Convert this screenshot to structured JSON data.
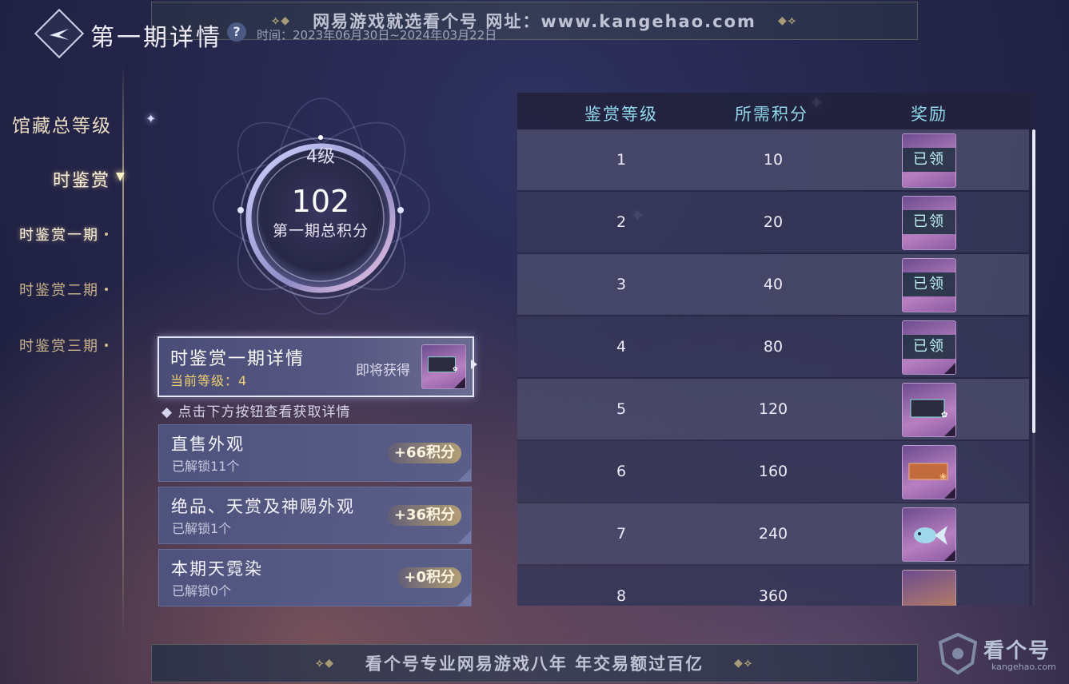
{
  "watermark": {
    "top_text": "网易游戏就选看个号  网址：www.kangehao.com",
    "bottom_text": "看个号专业网易游戏八年  年交易额过百亿"
  },
  "header": {
    "title": "第一期详情",
    "help_icon": "question-icon",
    "date_range": "时间：2023年06月30日~2024年03月22日"
  },
  "sidebar": {
    "top_label": "馆藏总等级",
    "group_label": "时鉴赏",
    "items": [
      {
        "label": "时鉴赏一期",
        "active": true
      },
      {
        "label": "时鉴赏二期",
        "active": false
      },
      {
        "label": "时鉴赏三期",
        "active": false
      }
    ]
  },
  "score": {
    "level": "4级",
    "total": "102",
    "label": "第一期总积分"
  },
  "detail_card": {
    "title": "时鉴赏一期详情",
    "current_level": "当前等级：4",
    "soon_label": "即将获得"
  },
  "hint": "◆ 点击下方按钮查看获取详情",
  "categories": [
    {
      "name": "直售外观",
      "unlocked": "已解锁11个",
      "points": "+66积分"
    },
    {
      "name": "绝品、天赏及神赐外观",
      "unlocked": "已解锁1个",
      "points": "+36积分"
    },
    {
      "name": "本期天霓染",
      "unlocked": "已解锁0个",
      "points": "+0积分"
    }
  ],
  "table": {
    "headers": [
      "鉴赏等级",
      "所需积分",
      "奖励"
    ],
    "claimed_label": "已领",
    "rows": [
      {
        "level": "1",
        "points": "10",
        "claimed": true
      },
      {
        "level": "2",
        "points": "20",
        "claimed": true
      },
      {
        "level": "3",
        "points": "40",
        "claimed": true
      },
      {
        "level": "4",
        "points": "80",
        "claimed": true
      },
      {
        "level": "5",
        "points": "120",
        "claimed": false
      },
      {
        "level": "6",
        "points": "160",
        "claimed": false
      },
      {
        "level": "7",
        "points": "240",
        "claimed": false
      },
      {
        "level": "8",
        "points": "360",
        "claimed": false
      }
    ]
  },
  "brand": {
    "name": "看个号",
    "url": "kangehao.com"
  },
  "colors": {
    "accent_cyan": "#8fd8ea",
    "points_gold": "#f0cf6e",
    "claimed_text": "#bff3f4"
  }
}
